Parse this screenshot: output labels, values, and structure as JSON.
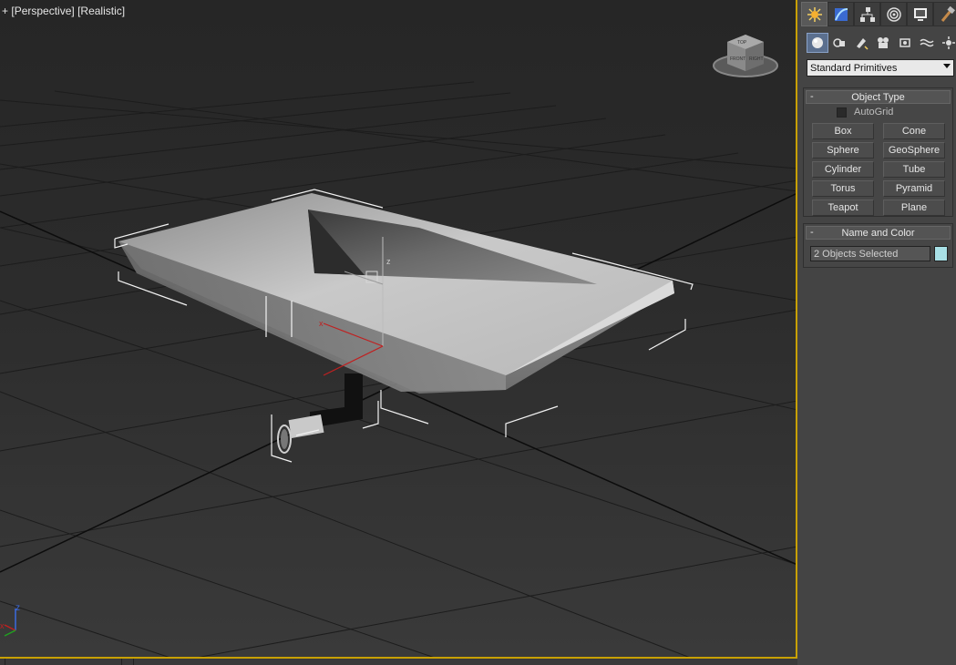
{
  "viewport": {
    "label_plus": "+",
    "label_view": "[Perspective]",
    "label_shading": "[Realistic]",
    "viewcube": {
      "top": "TOP",
      "front": "FRONT",
      "right": "RIGHT"
    },
    "axis_tripod": {
      "z": "z",
      "x": "x"
    },
    "gizmo_labels": {
      "z": "z",
      "x": "x"
    }
  },
  "command_panel": {
    "tabs": [
      "create-icon",
      "modify-icon",
      "hierarchy-icon",
      "motion-icon",
      "display-icon",
      "utilities-icon"
    ],
    "subtabs": [
      "geometry-icon",
      "shapes-icon",
      "lights-icon",
      "cameras-icon",
      "helpers-icon",
      "space-warps-icon",
      "systems-icon"
    ],
    "category_dropdown": "Standard Primitives",
    "object_type": {
      "title": "Object Type",
      "collapse": "-",
      "autogrid": "AutoGrid",
      "buttons": [
        "Box",
        "Cone",
        "Sphere",
        "GeoSphere",
        "Cylinder",
        "Tube",
        "Torus",
        "Pyramid",
        "Teapot",
        "Plane"
      ]
    },
    "name_and_color": {
      "title": "Name and Color",
      "collapse": "-",
      "name_value": "2 Objects Selected",
      "color": "#a8e0e6"
    }
  },
  "colors": {
    "active_border": "#c8a000",
    "panel_bg": "#444444"
  }
}
